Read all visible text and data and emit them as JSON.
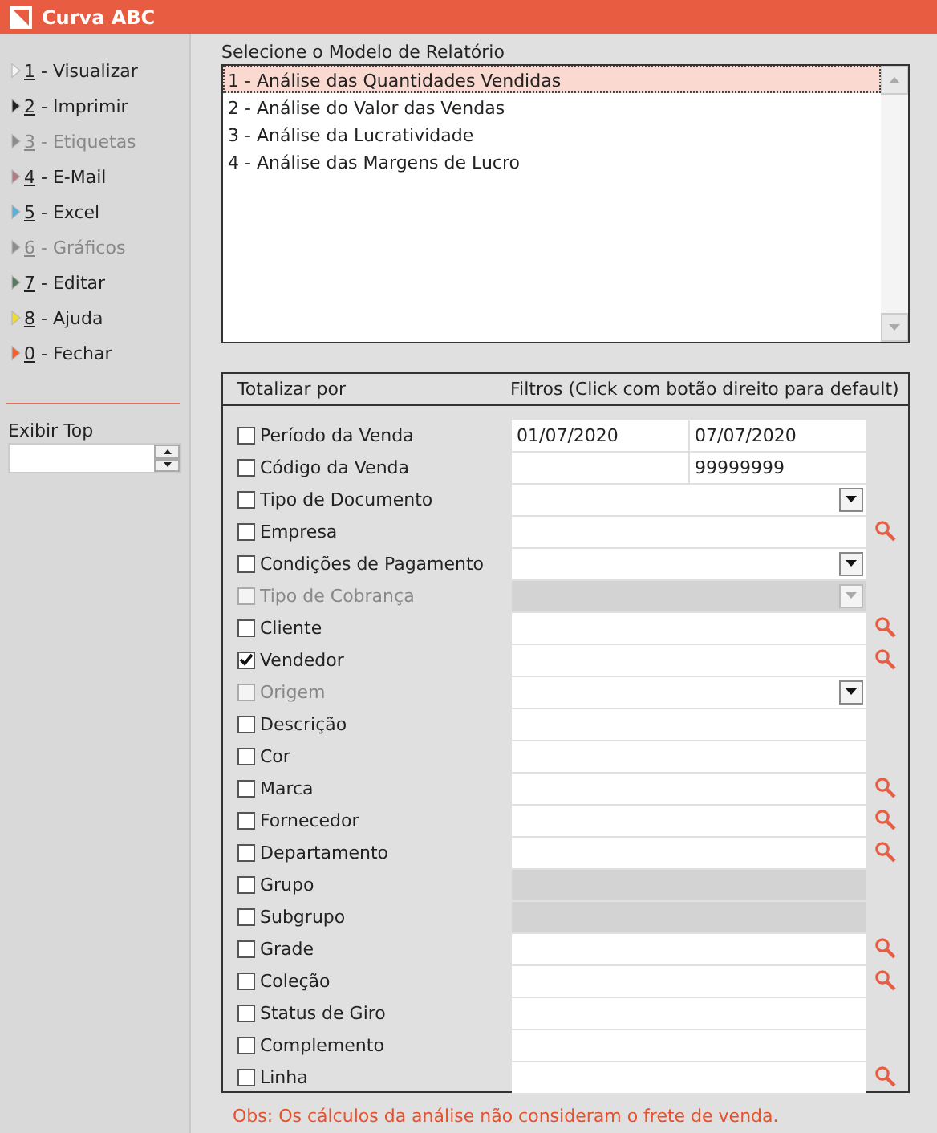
{
  "window": {
    "title": "Curva ABC"
  },
  "menu": [
    {
      "key": "1",
      "label": "- Visualizar",
      "color": "#f4f4f4",
      "disabled": false
    },
    {
      "key": "2",
      "label": "- Imprimir",
      "color": "#222222",
      "disabled": false
    },
    {
      "key": "3",
      "label": "- Etiquetas",
      "color": "#8c8c8c",
      "disabled": true
    },
    {
      "key": "4",
      "label": "- E-Mail",
      "color": "#b07c84",
      "disabled": false
    },
    {
      "key": "5",
      "label": "- Excel",
      "color": "#5aafd8",
      "disabled": false
    },
    {
      "key": "6",
      "label": "- Gráficos",
      "color": "#8c8c8c",
      "disabled": true
    },
    {
      "key": "7",
      "label": "- Editar",
      "color": "#5a7a60",
      "disabled": false
    },
    {
      "key": "8",
      "label": "- Ajuda",
      "color": "#f0dc30",
      "disabled": false
    },
    {
      "key": "0",
      "label": "- Fechar",
      "color": "#f06030",
      "disabled": false
    }
  ],
  "top": {
    "label": "Exibir Top"
  },
  "models": {
    "label": "Selecione o Modelo de Relatório",
    "items": [
      {
        "label": "1 - Análise das Quantidades Vendidas",
        "selected": true
      },
      {
        "label": "2 - Análise do Valor das Vendas",
        "selected": false
      },
      {
        "label": "3 - Análise da Lucratividade",
        "selected": false
      },
      {
        "label": "4 - Análise das Margens de Lucro",
        "selected": false
      }
    ]
  },
  "filters": {
    "column_1": "Totalizar por",
    "column_2": "Filtros (Click com botão direito para default)",
    "rows": [
      {
        "label": "Período da Venda",
        "checked": false,
        "disabled": false,
        "filter": {
          "kind": "range",
          "from": "01/07/2020",
          "to": "07/07/2020"
        }
      },
      {
        "label": "Código da Venda",
        "checked": false,
        "disabled": false,
        "filter": {
          "kind": "range",
          "to": "99999999"
        }
      },
      {
        "label": "Tipo de Documento",
        "checked": false,
        "disabled": false,
        "filter": {
          "kind": "select",
          "disabled": false
        }
      },
      {
        "label": "Empresa",
        "checked": false,
        "disabled": false,
        "filter": {
          "kind": "lookup",
          "disabled": false
        }
      },
      {
        "label": "Condições de Pagamento",
        "checked": false,
        "disabled": false,
        "filter": {
          "kind": "select",
          "disabled": false
        }
      },
      {
        "label": "Tipo de Cobrança",
        "checked": false,
        "disabled": true,
        "filter": {
          "kind": "select",
          "disabled": true
        }
      },
      {
        "label": "Cliente",
        "checked": false,
        "disabled": false,
        "filter": {
          "kind": "lookup",
          "disabled": false
        }
      },
      {
        "label": "Vendedor",
        "checked": true,
        "disabled": false,
        "filter": {
          "kind": "lookup",
          "disabled": false
        }
      },
      {
        "label": "Origem",
        "checked": false,
        "disabled": true,
        "filter": {
          "kind": "select",
          "disabled": false
        }
      },
      {
        "label": "Descrição",
        "checked": false,
        "disabled": false,
        "filter": {
          "kind": "text",
          "disabled": false
        }
      },
      {
        "label": "Cor",
        "checked": false,
        "disabled": false,
        "filter": {
          "kind": "text",
          "disabled": false
        }
      },
      {
        "label": "Marca",
        "checked": false,
        "disabled": false,
        "filter": {
          "kind": "lookup",
          "disabled": false
        }
      },
      {
        "label": "Fornecedor",
        "checked": false,
        "disabled": false,
        "filter": {
          "kind": "lookup",
          "disabled": false
        }
      },
      {
        "label": "Departamento",
        "checked": false,
        "disabled": false,
        "filter": {
          "kind": "lookup",
          "disabled": false
        }
      },
      {
        "label": "Grupo",
        "checked": false,
        "disabled": false,
        "filter": {
          "kind": "text",
          "disabled": true
        }
      },
      {
        "label": "Subgrupo",
        "checked": false,
        "disabled": false,
        "filter": {
          "kind": "text",
          "disabled": true
        }
      },
      {
        "label": "Grade",
        "checked": false,
        "disabled": false,
        "filter": {
          "kind": "lookup",
          "disabled": false
        }
      },
      {
        "label": "Coleção",
        "checked": false,
        "disabled": false,
        "filter": {
          "kind": "lookup",
          "disabled": false
        }
      },
      {
        "label": "Status de Giro",
        "checked": false,
        "disabled": false,
        "filter": {
          "kind": "text",
          "disabled": false
        }
      },
      {
        "label": "Complemento",
        "checked": false,
        "disabled": false,
        "filter": {
          "kind": "text",
          "disabled": false
        }
      },
      {
        "label": "Linha",
        "checked": false,
        "disabled": false,
        "filter": {
          "kind": "lookup",
          "disabled": false
        }
      }
    ]
  },
  "note": "Obs: Os cálculos da análise não consideram o frete de venda."
}
